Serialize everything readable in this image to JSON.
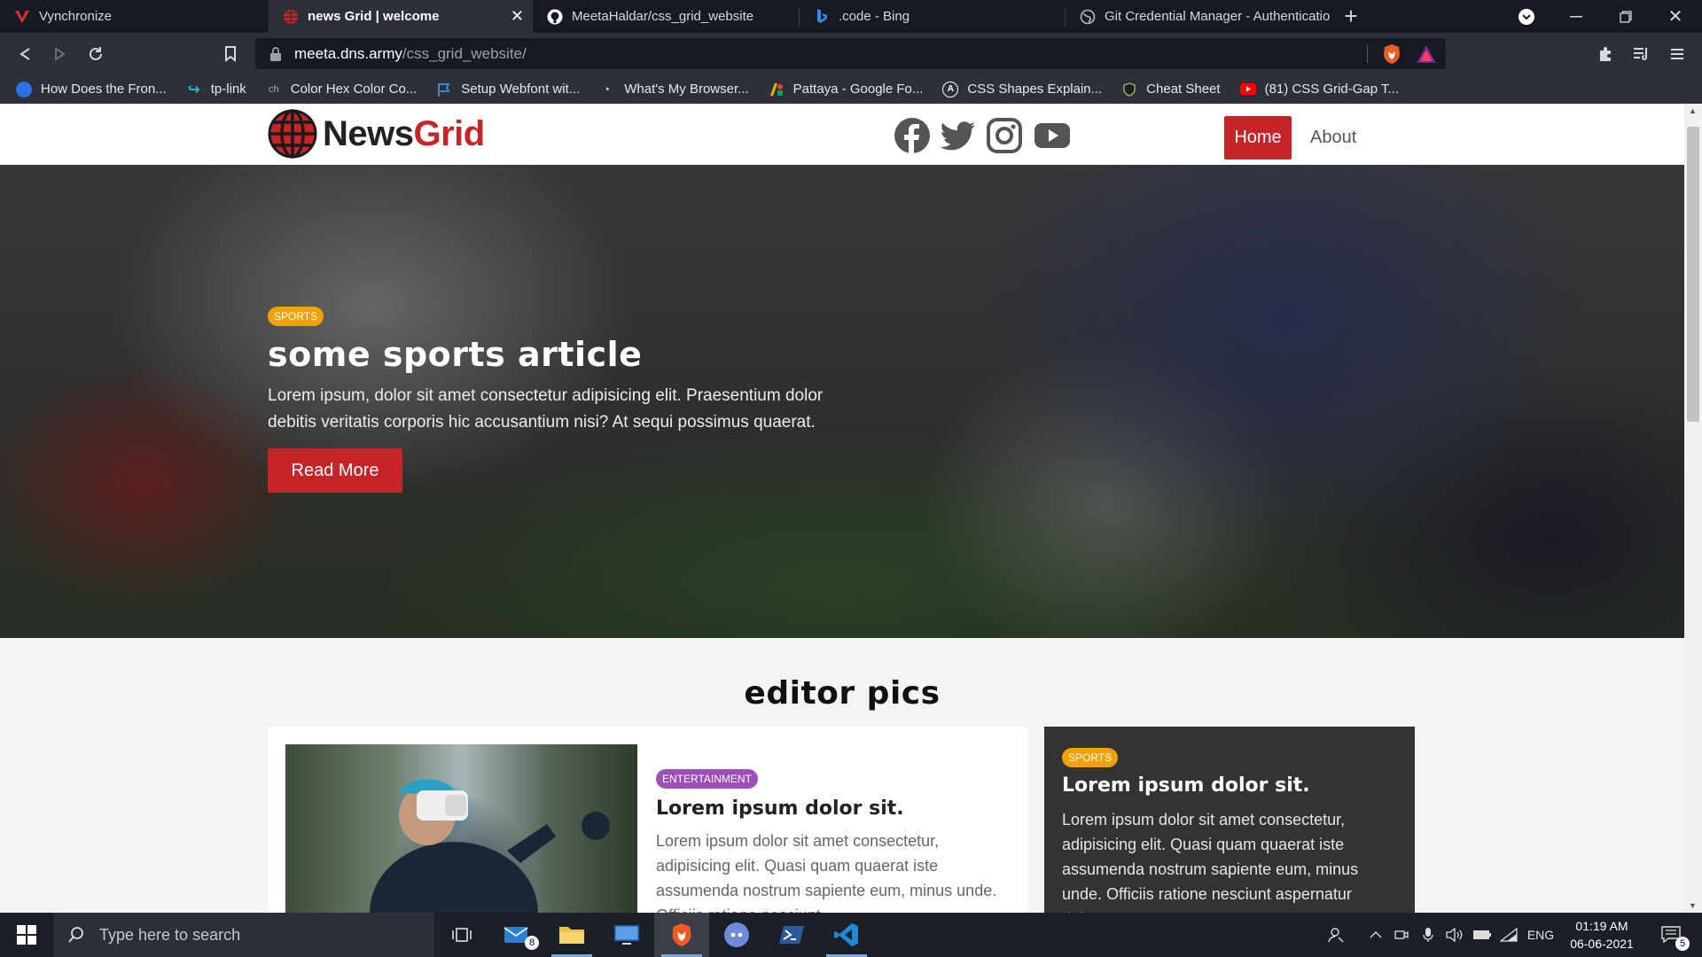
{
  "browser": {
    "tabs": [
      {
        "title": "Vynchronize",
        "active": false
      },
      {
        "title": "news Grid | welcome",
        "active": true
      },
      {
        "title": "MeetaHaldar/css_grid_website",
        "active": false
      },
      {
        "title": ".code - Bing",
        "active": false
      },
      {
        "title": "Git Credential Manager - Authenticatio",
        "active": false
      }
    ],
    "url_host": "meeta.dns.army",
    "url_path": "/css_grid_website/",
    "bookmarks": [
      "How Does the Fron...",
      "tp-link",
      "Color Hex Color Co...",
      "Setup Webfont wit...",
      "What's My Browser...",
      "Pattaya - Google Fo...",
      "CSS Shapes Explain...",
      "Cheat Sheet",
      "(81) CSS Grid-Gap T..."
    ]
  },
  "site": {
    "brand_a": "News",
    "brand_b": "Grid",
    "nav": {
      "home": "Home",
      "about": "About"
    },
    "social_icons": [
      "facebook-icon",
      "twitter-icon",
      "instagram-icon",
      "youtube-icon"
    ],
    "hero": {
      "category": "SPORTS",
      "title": "some sports article",
      "text": "Lorem ipsum, dolor sit amet consectetur adipisicing elit. Praesentium dolor debitis veritatis corporis hic accusantium nisi? At sequi possimus quaerat.",
      "button": "Read More"
    },
    "editor_title": "editor pics",
    "cards": [
      {
        "category": "ENTERTAINMENT",
        "title": "Lorem ipsum dolor sit.",
        "text": "Lorem ipsum dolor sit amet consectetur, adipisicing elit. Quasi quam quaerat iste assumenda nostrum sapiente eum, minus unde. Officiis ratione nesciunt"
      },
      {
        "category": "SPORTS",
        "title": "Lorem ipsum dolor sit.",
        "text": "Lorem ipsum dolor sit amet consectetur, adipisicing elit. Quasi quam quaerat iste assumenda nostrum sapiente eum, minus unde. Officiis ratione nesciunt aspernatur dolorem,"
      }
    ]
  },
  "taskbar": {
    "search_placeholder": "Type here to search",
    "mail_badge": "8",
    "language": "ENG",
    "time": "01:19 AM",
    "date": "06-06-2021",
    "notifications": "5"
  },
  "colors": {
    "accent_red": "#c52528",
    "sports_orange": "#f1a200",
    "entertainment_purple": "#9c4fb8"
  }
}
